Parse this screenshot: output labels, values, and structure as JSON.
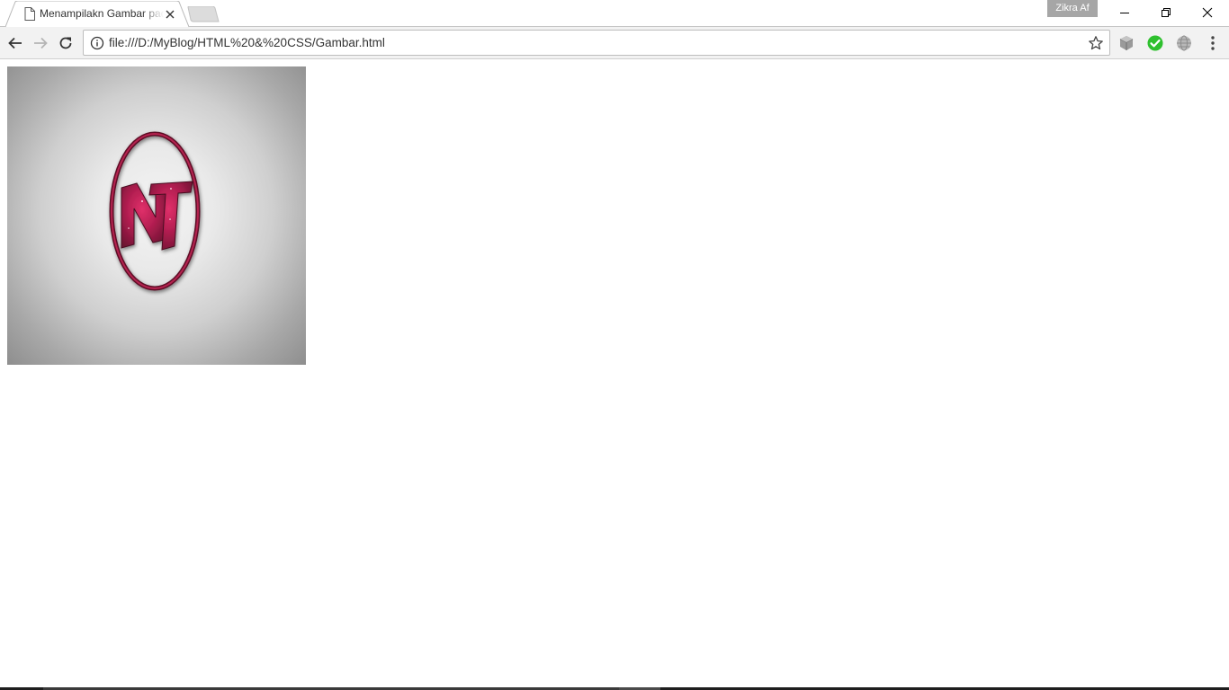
{
  "browser": {
    "active_tab": {
      "title": "Menampilakn Gambar pada HTML",
      "close_label": "×"
    },
    "profile_name": "Zikra Af",
    "omnibox": {
      "url": "file:///D:/MyBlog/HTML%20&%20CSS/Gambar.html"
    },
    "icons": {
      "tab_favicon": "page-icon",
      "back": "arrow-left-icon",
      "forward": "arrow-right-icon",
      "reload": "reload-icon",
      "info": "info-icon",
      "bookmark": "star-icon",
      "extensions": [
        "cube-extension-icon",
        "check-circle-icon",
        "globe-icon"
      ],
      "menu": "kebab-menu-icon"
    },
    "colors": {
      "check_green": "#2ec02e",
      "toolbar_bg": "#f2f2f2",
      "logo_crimson": "#8e1a3a"
    }
  },
  "page": {
    "image": {
      "logo_letters": "NT"
    }
  }
}
